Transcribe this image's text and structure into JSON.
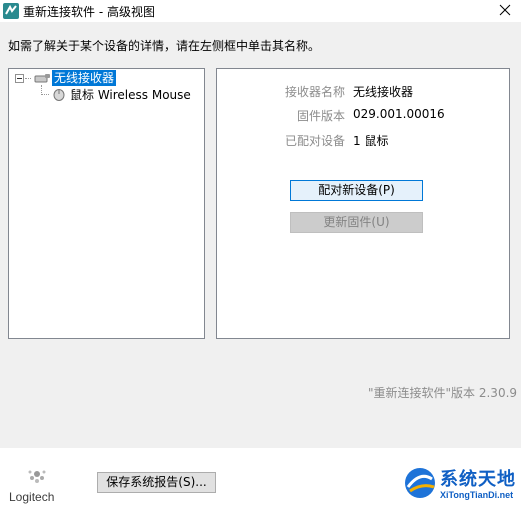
{
  "window": {
    "title": "重新连接软件 - 高级视图",
    "close_symbol": "✕"
  },
  "instruction": "如需了解关于某个设备的详情，请在左侧框中单击其名称。",
  "tree": {
    "receiver_label": "无线接收器",
    "device_label": "鼠标 Wireless Mouse"
  },
  "details": {
    "rows": [
      {
        "key": "接收器名称",
        "value": "无线接收器"
      },
      {
        "key": "固件版本",
        "value": "029.001.00016"
      },
      {
        "key": "已配对设备",
        "value": "1 鼠标"
      }
    ],
    "pair_button": "配对新设备(P)",
    "update_button": "更新固件(U)"
  },
  "version_text": "\"重新连接软件\"版本 2.30.9",
  "footer": {
    "logo_text": "Logitech",
    "report_button": "保存系统报告(S)...",
    "watermark_title": "系统天地",
    "watermark_url": "XiTongTianDi.net"
  },
  "colors": {
    "selection": "#0078d7",
    "watermark": "#0f5fc4"
  }
}
